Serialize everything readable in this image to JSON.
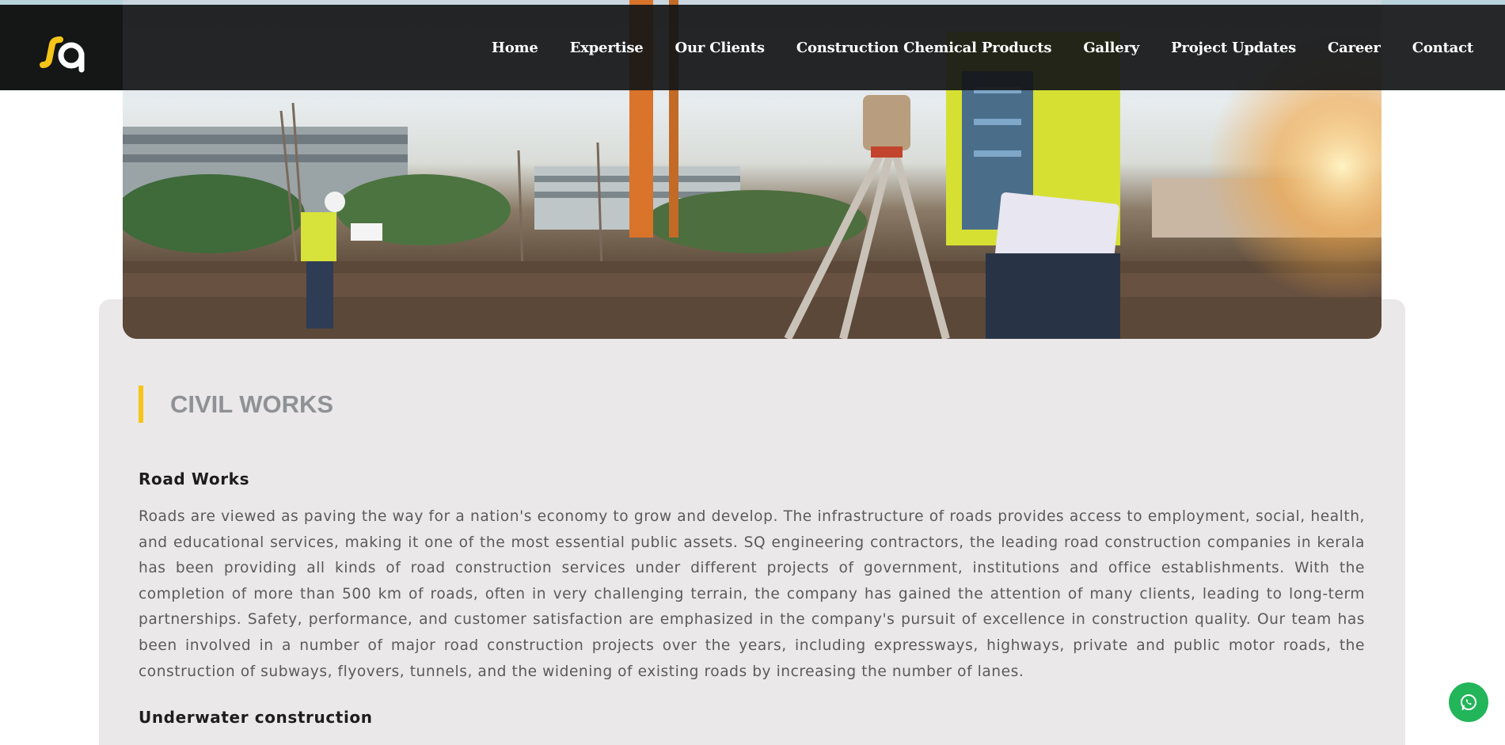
{
  "brand": {
    "logo_text": "SQ",
    "accent_color": "#f5c518"
  },
  "nav": {
    "items": [
      {
        "label": "Home"
      },
      {
        "label": "Expertise"
      },
      {
        "label": "Our Clients"
      },
      {
        "label": "Construction Chemical Products"
      },
      {
        "label": "Gallery"
      },
      {
        "label": "Project Updates"
      },
      {
        "label": "Career"
      },
      {
        "label": "Contact"
      }
    ]
  },
  "content": {
    "section_title": "CIVIL WORKS",
    "road_works": {
      "title": "Road Works",
      "body": "Roads are viewed as paving the way for a nation's economy to grow and develop. The infrastructure of roads provides access to employment, social, health, and educational services, making it one of the most essential public assets. SQ engineering contractors, the leading road construction companies in kerala has been providing all kinds of road construction services under different projects of government, institutions and office establishments. With the completion of more than 500 km of roads, often in very challenging terrain, the company has gained the attention of many clients, leading to long-term partnerships. Safety, performance, and customer satisfaction are emphasized in the company's pursuit of excellence in construction quality. Our team has been involved in a number of major road construction projects over the years, including expressways, highways, private and public motor roads, the construction of subways, flyovers, tunnels, and the widening of existing roads by increasing the number of lanes."
    },
    "underwater": {
      "title": "Underwater construction"
    }
  },
  "floating": {
    "whatsapp_icon": "whatsapp-icon",
    "whatsapp_color": "#22b55a"
  }
}
